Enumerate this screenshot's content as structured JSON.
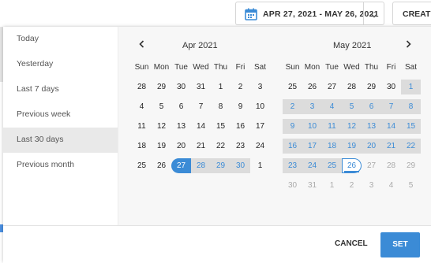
{
  "toolbar": {
    "date_range": "APR 27, 2021 - MAY 26, 2021",
    "create_label": "CREATE",
    "calendar_icon": "calendar-icon",
    "chevron_icon": "chevron-down-icon"
  },
  "presets": [
    {
      "label": "Today",
      "active": false
    },
    {
      "label": "Yesterday",
      "active": false
    },
    {
      "label": "Last 7 days",
      "active": false
    },
    {
      "label": "Previous week",
      "active": false
    },
    {
      "label": "Last 30 days",
      "active": true
    },
    {
      "label": "Previous month",
      "active": false
    }
  ],
  "weekdays": [
    "Sun",
    "Mon",
    "Tue",
    "Wed",
    "Thu",
    "Fri",
    "Sat"
  ],
  "months": [
    {
      "title": "Apr 2021",
      "weeks": [
        [
          {
            "d": "28",
            "s": ""
          },
          {
            "d": "29",
            "s": ""
          },
          {
            "d": "30",
            "s": ""
          },
          {
            "d": "31",
            "s": ""
          },
          {
            "d": "1",
            "s": ""
          },
          {
            "d": "2",
            "s": ""
          },
          {
            "d": "3",
            "s": ""
          }
        ],
        [
          {
            "d": "4",
            "s": ""
          },
          {
            "d": "5",
            "s": ""
          },
          {
            "d": "6",
            "s": ""
          },
          {
            "d": "7",
            "s": ""
          },
          {
            "d": "8",
            "s": ""
          },
          {
            "d": "9",
            "s": ""
          },
          {
            "d": "10",
            "s": ""
          }
        ],
        [
          {
            "d": "11",
            "s": ""
          },
          {
            "d": "12",
            "s": ""
          },
          {
            "d": "13",
            "s": ""
          },
          {
            "d": "14",
            "s": ""
          },
          {
            "d": "15",
            "s": ""
          },
          {
            "d": "16",
            "s": ""
          },
          {
            "d": "17",
            "s": ""
          }
        ],
        [
          {
            "d": "18",
            "s": ""
          },
          {
            "d": "19",
            "s": ""
          },
          {
            "d": "20",
            "s": ""
          },
          {
            "d": "21",
            "s": ""
          },
          {
            "d": "22",
            "s": ""
          },
          {
            "d": "23",
            "s": ""
          },
          {
            "d": "24",
            "s": ""
          }
        ],
        [
          {
            "d": "25",
            "s": ""
          },
          {
            "d": "26",
            "s": ""
          },
          {
            "d": "27",
            "s": "start"
          },
          {
            "d": "28",
            "s": "in"
          },
          {
            "d": "29",
            "s": "in"
          },
          {
            "d": "30",
            "s": "in"
          },
          {
            "d": "1",
            "s": ""
          }
        ]
      ]
    },
    {
      "title": "May 2021",
      "weeks": [
        [
          {
            "d": "25",
            "s": ""
          },
          {
            "d": "26",
            "s": ""
          },
          {
            "d": "27",
            "s": ""
          },
          {
            "d": "28",
            "s": ""
          },
          {
            "d": "29",
            "s": ""
          },
          {
            "d": "30",
            "s": ""
          },
          {
            "d": "1",
            "s": "in"
          }
        ],
        [
          {
            "d": "2",
            "s": "in"
          },
          {
            "d": "3",
            "s": "in"
          },
          {
            "d": "4",
            "s": "in"
          },
          {
            "d": "5",
            "s": "in"
          },
          {
            "d": "6",
            "s": "in"
          },
          {
            "d": "7",
            "s": "in"
          },
          {
            "d": "8",
            "s": "in"
          }
        ],
        [
          {
            "d": "9",
            "s": "in"
          },
          {
            "d": "10",
            "s": "in"
          },
          {
            "d": "11",
            "s": "in"
          },
          {
            "d": "12",
            "s": "in"
          },
          {
            "d": "13",
            "s": "in"
          },
          {
            "d": "14",
            "s": "in"
          },
          {
            "d": "15",
            "s": "in"
          }
        ],
        [
          {
            "d": "16",
            "s": "in"
          },
          {
            "d": "17",
            "s": "in"
          },
          {
            "d": "18",
            "s": "in"
          },
          {
            "d": "19",
            "s": "in"
          },
          {
            "d": "20",
            "s": "in"
          },
          {
            "d": "21",
            "s": "in"
          },
          {
            "d": "22",
            "s": "in"
          }
        ],
        [
          {
            "d": "23",
            "s": "in"
          },
          {
            "d": "24",
            "s": "in"
          },
          {
            "d": "25",
            "s": "in"
          },
          {
            "d": "26",
            "s": "end"
          },
          {
            "d": "27",
            "s": "muted"
          },
          {
            "d": "28",
            "s": "muted"
          },
          {
            "d": "29",
            "s": "muted"
          }
        ],
        [
          {
            "d": "30",
            "s": "muted"
          },
          {
            "d": "31",
            "s": "muted"
          },
          {
            "d": "1",
            "s": "muted"
          },
          {
            "d": "2",
            "s": "muted"
          },
          {
            "d": "3",
            "s": "muted"
          },
          {
            "d": "4",
            "s": "muted"
          },
          {
            "d": "5",
            "s": "muted"
          }
        ]
      ]
    }
  ],
  "footer": {
    "cancel_label": "CANCEL",
    "set_label": "SET"
  },
  "colors": {
    "accent": "#3b8bd6",
    "range_bg": "#dcdcdc",
    "preset_active_bg": "#e9e9e9"
  }
}
